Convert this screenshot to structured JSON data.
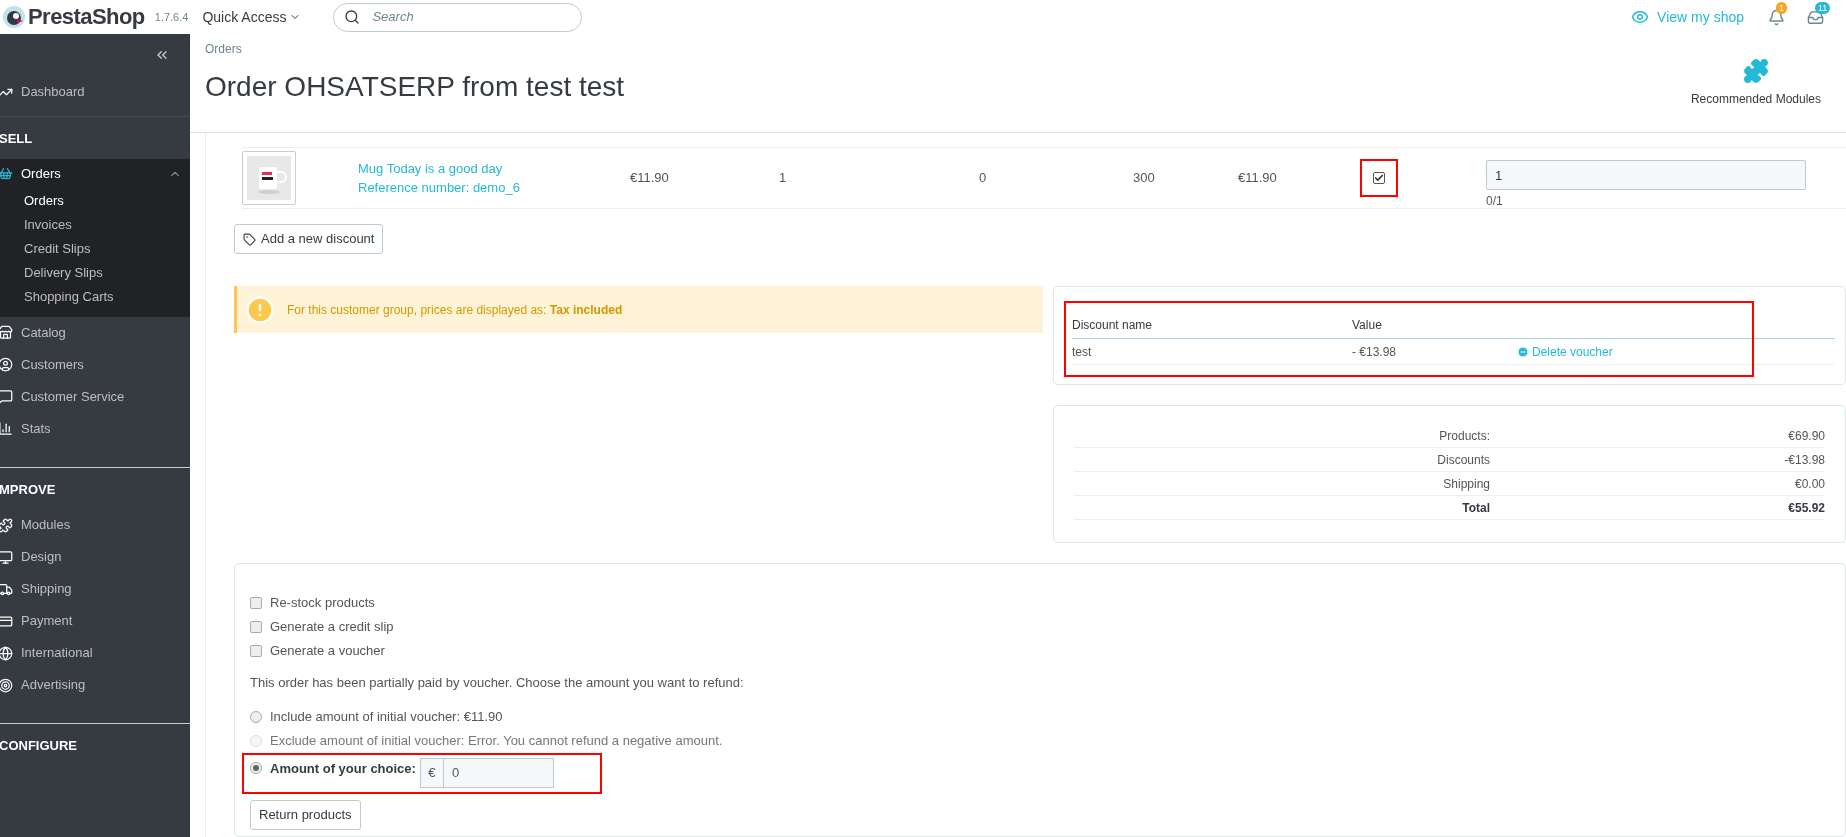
{
  "topbar": {
    "logo": "PrestaShop",
    "version": "1.7.6.4",
    "quick_access": "Quick Access",
    "search": {
      "placeholder": "Search"
    },
    "view_shop": "View my shop",
    "notifications": [
      {
        "kind": "bell",
        "count": "1",
        "color": "#f5a623"
      },
      {
        "kind": "orders",
        "count": "11",
        "color": "#25b9d7"
      }
    ]
  },
  "sidebar": {
    "items": [
      {
        "kind": "link",
        "label": "Dashboard"
      },
      {
        "kind": "section",
        "label": "SELL"
      },
      {
        "kind": "group",
        "label": "Orders",
        "expanded": true,
        "children": [
          {
            "label": "Orders",
            "selected": true
          },
          {
            "label": "Invoices",
            "selected": false
          },
          {
            "label": "Credit Slips",
            "selected": false
          },
          {
            "label": "Delivery Slips",
            "selected": false
          },
          {
            "label": "Shopping Carts",
            "selected": false
          }
        ]
      },
      {
        "kind": "link",
        "label": "Catalog"
      },
      {
        "kind": "link",
        "label": "Customers"
      },
      {
        "kind": "link",
        "label": "Customer Service"
      },
      {
        "kind": "link",
        "label": "Stats"
      },
      {
        "kind": "section",
        "label": "MPROVE"
      },
      {
        "kind": "link",
        "label": "Modules"
      },
      {
        "kind": "link",
        "label": "Design"
      },
      {
        "kind": "link",
        "label": "Shipping"
      },
      {
        "kind": "link",
        "label": "Payment"
      },
      {
        "kind": "link",
        "label": "International"
      },
      {
        "kind": "link",
        "label": "Advertising"
      },
      {
        "kind": "section",
        "label": "CONFIGURE"
      }
    ]
  },
  "header": {
    "breadcrumb": "Orders",
    "title": "Order OHSATSERP from test test",
    "toolbar": [
      {
        "label": "Recommended Modules"
      }
    ]
  },
  "product_row": {
    "name": "Mug Today is a good day",
    "reference": "Reference number: demo_6",
    "unit_price": "€11.90",
    "quantity": "1",
    "refunded": "0",
    "stock": "300",
    "total": "€11.90",
    "checked": true,
    "return_quantity": "1",
    "return_hint": "0/1"
  },
  "add_discount": "Add a new discount",
  "alert": {
    "text": "For this customer group, prices are displayed as: **Tax included**"
  },
  "discounts": {
    "columns": [
      "Discount name",
      "Value"
    ],
    "rows": [
      {
        "name": "test",
        "value": "- €13.98",
        "action": "Delete voucher"
      }
    ]
  },
  "totals": [
    {
      "label": "Products:",
      "value": "€69.90",
      "bold": false
    },
    {
      "label": "Discounts",
      "value": "-€13.98",
      "bold": false
    },
    {
      "label": "Shipping",
      "value": "€0.00",
      "bold": false
    },
    {
      "label": "Total",
      "value": "€55.92",
      "bold": true
    }
  ],
  "return_form": {
    "options": [
      {
        "label": "Re-stock products",
        "checked": false
      },
      {
        "label": "Generate a credit slip",
        "checked": false
      },
      {
        "label": "Generate a voucher",
        "checked": false
      }
    ],
    "note": "This order has been partially paid by voucher. Choose the amount you want to refund:",
    "refund_choices": [
      {
        "label": "Include amount of initial voucher: €11.90",
        "selected": false,
        "disabled": false
      },
      {
        "label": "Exclude amount of initial voucher: Error. You cannot refund a negative amount.",
        "selected": false,
        "disabled": true
      },
      {
        "label": "Amount of your choice:",
        "selected": true,
        "disabled": false,
        "currency": "€",
        "value": "0"
      }
    ],
    "submit": "Return products"
  }
}
